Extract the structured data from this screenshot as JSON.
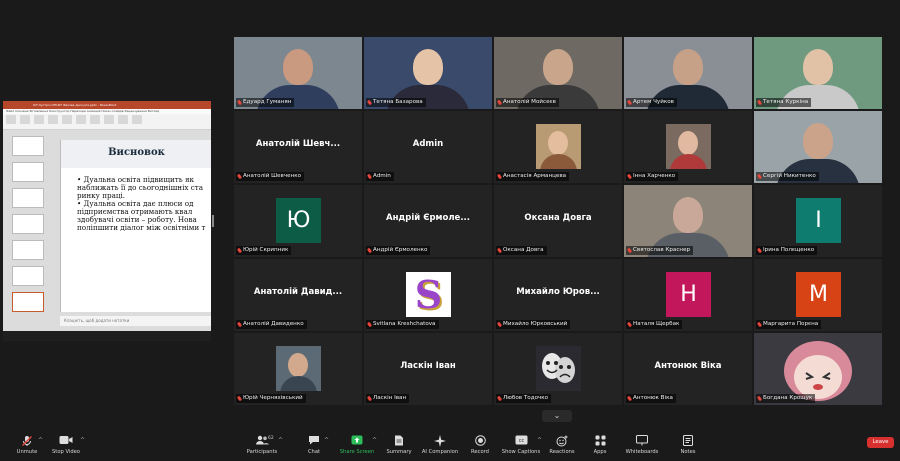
{
  "share": {
    "window_title": "ІСТ-Зустріч ОНІ-БТ Фахова дискусія.pptx - PowerPoint",
    "ribbon_tabs": "Файл  Основне  Вставлення  Конструктор  Переходи  Анімація  Показ слайдів  Рецензування  Вигляд",
    "slide": {
      "title": "Висновок",
      "text": "• Дуальна освіта підвищить як\n   наближать її до сьогоднішніх ста\n   ринку праці.\n• Дуальна освіта дає плюси од\n   підприємства отримають квал\n   здобувачі освіти – роботу. Нова\n   поліпшити діалог між освітніми т"
    },
    "notes": "Клацніть, щоб додати нотатки"
  },
  "tiles": [
    {
      "label": "Едуард Гуманян",
      "type": "video",
      "speaking": false,
      "bg": "#7d8790",
      "skin": "#c99a7f",
      "shirt": "#2f3e5c"
    },
    {
      "label": "Тетяна Базарова",
      "type": "video",
      "speaking": false,
      "bg": "#3a4a6a",
      "skin": "#e5c3a6",
      "shirt": "#2a2a3a"
    },
    {
      "label": "Анатолій Мойсеєв",
      "type": "video",
      "speaking": false,
      "bg": "#6e6a63",
      "skin": "#c9a58c",
      "shirt": "#3a3a3a"
    },
    {
      "label": "Артем Чуйков",
      "type": "video",
      "speaking": false,
      "bg": "#8a8f95",
      "skin": "#c7a088",
      "shirt": "#1f2a36"
    },
    {
      "label": "Тетяна Куркіна",
      "type": "video",
      "speaking": false,
      "bg": "#6f9a80",
      "skin": "#e1c2a7",
      "shirt": "#c9c9c9"
    },
    {
      "label": "Анатолій Шевченко",
      "type": "name",
      "name": "Анатолій Шевч...",
      "speaking": false
    },
    {
      "label": "Admin",
      "type": "name",
      "name": "Admin",
      "speaking": false
    },
    {
      "label": "Анастасія Арманцева",
      "type": "photo",
      "speaking": false,
      "bg": "#b89a73",
      "skin": "#e3bd9e",
      "shirt": "#8a5a3a"
    },
    {
      "label": "Інна Харченко",
      "type": "photo",
      "speaking": false,
      "bg": "#7a6a60",
      "skin": "#e1b9a0",
      "shirt": "#b03a3a"
    },
    {
      "label": "Сергій Никитенко",
      "type": "video",
      "speaking": true,
      "bg": "#9aa4a8",
      "skin": "#caa38a",
      "shirt": "#27313f"
    },
    {
      "label": "Юрій Скрипник",
      "type": "initial",
      "initial": "Ю",
      "color": "#0d5c45",
      "speaking": false
    },
    {
      "label": "Андрій Єрмоленко",
      "type": "name",
      "name": "Андрій Єрмоле...",
      "speaking": false
    },
    {
      "label": "Оксана Довга",
      "type": "name",
      "name": "Оксана Довга",
      "speaking": false
    },
    {
      "label": "Святослав Краснер",
      "type": "video",
      "speaking": false,
      "bg": "#8c8478",
      "skin": "#c9a89a",
      "shirt": "#5a5f66"
    },
    {
      "label": "Ірина Полєщенко",
      "type": "initial",
      "initial": "І",
      "color": "#0e7c6e",
      "speaking": false
    },
    {
      "label": "Анатолій Давиденко",
      "type": "name",
      "name": "Анатолій Давид...",
      "speaking": false
    },
    {
      "label": "Svitlana Kreshchatova",
      "type": "logo",
      "initial": "S",
      "speaking": false
    },
    {
      "label": "Михайло Юрковський",
      "type": "name",
      "name": "Михайло Юров...",
      "speaking": false
    },
    {
      "label": "Наталя Щербак",
      "type": "initial",
      "initial": "Н",
      "color": "#c2185b",
      "speaking": false
    },
    {
      "label": "Маргарита Порєна",
      "type": "initial",
      "initial": "М",
      "color": "#d84315",
      "speaking": false
    },
    {
      "label": "Юрій Черняхівський",
      "type": "photo",
      "speaking": false,
      "bg": "#5c6a75",
      "skin": "#d2a98d",
      "shirt": "#3a4552"
    },
    {
      "label": "Ласкін Іван",
      "type": "name",
      "name": "Ласкін Іван",
      "speaking": false
    },
    {
      "label": "Любов Тодочко",
      "type": "masks",
      "speaking": false
    },
    {
      "label": "Антонюк Віка",
      "type": "name",
      "name": "Антонюк Віка",
      "speaking": false
    },
    {
      "label": "Богдана Крощук",
      "type": "anime",
      "speaking": false
    }
  ],
  "toolbar": {
    "unmute": "Unmute",
    "stop_video": "Stop Video",
    "participants": "Participants",
    "participants_count": "62",
    "chat": "Chat",
    "share_screen": "Share Screen",
    "summary": "Summary",
    "ai_companion": "AI Companion",
    "record": "Record",
    "show_captions": "Show Captions",
    "reactions": "Reactions",
    "apps": "Apps",
    "whiteboards": "Whiteboards",
    "notes": "Notes",
    "leave": "Leave"
  },
  "colors": {
    "background": "#1a1a1a",
    "tile": "#232323",
    "speaking_border": "#c8e63c",
    "leave": "#d8302f",
    "share_green": "#2dbd5b",
    "muted_mic": "#e8453c"
  }
}
